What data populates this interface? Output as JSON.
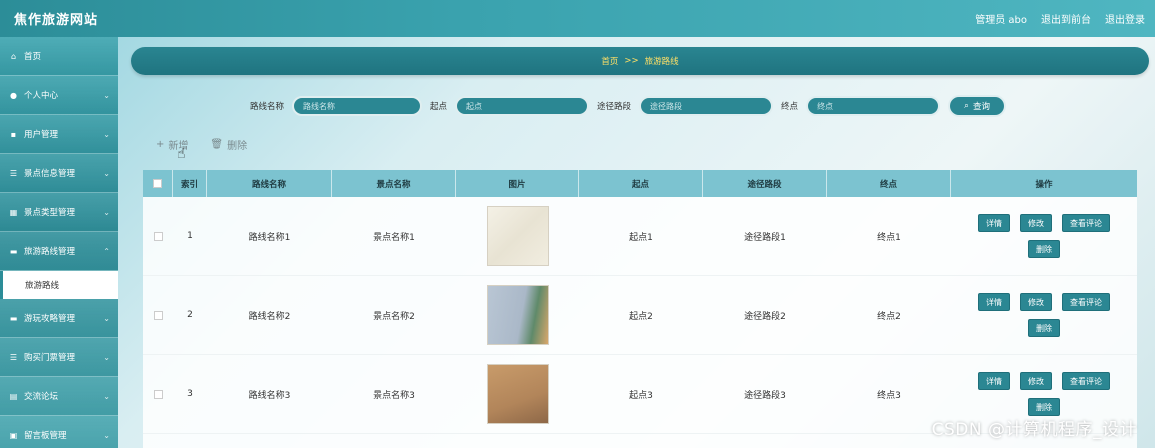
{
  "topbar": {
    "site_title": "焦作旅游网站",
    "admin_label": "管理员 abo",
    "to_front": "退出到前台",
    "logout": "退出登录"
  },
  "sidebar": {
    "items": [
      {
        "icon": "home-icon",
        "label": "首页"
      },
      {
        "icon": "user-icon",
        "label": "个人中心"
      },
      {
        "icon": "users-icon",
        "label": "用户管理"
      },
      {
        "icon": "list-icon",
        "label": "景点信息管理"
      },
      {
        "icon": "grid-icon",
        "label": "景点类型管理"
      },
      {
        "icon": "route-icon",
        "label": "旅游路线管理"
      }
    ],
    "active_sub": "旅游路线",
    "items_after": [
      {
        "icon": "guide-icon",
        "label": "游玩攻略管理"
      },
      {
        "icon": "ticket-icon",
        "label": "购买门票管理"
      },
      {
        "icon": "forum-icon",
        "label": "交流论坛"
      },
      {
        "icon": "message-icon",
        "label": "留言板管理"
      }
    ]
  },
  "breadcrumb": {
    "home": "首页",
    "sep": ">>",
    "current": "旅游路线"
  },
  "search": {
    "route_label": "路线名称",
    "route_placeholder": "路线名称",
    "start_label": "起点",
    "start_placeholder": "起点",
    "via_label": "途径路段",
    "via_placeholder": "途径路段",
    "end_label": "终点",
    "end_placeholder": "终点",
    "button_label": "查询"
  },
  "actions": {
    "add_label": "新增",
    "delete_label": "删除"
  },
  "table": {
    "headers": {
      "index": "索引",
      "route": "路线名称",
      "spot": "景点名称",
      "image": "图片",
      "start": "起点",
      "via": "途径路段",
      "end": "终点",
      "ops": "操作"
    },
    "rows": [
      {
        "index": "1",
        "route": "路线名称1",
        "spot": "景点名称1",
        "start": "起点1",
        "via": "途径路段1",
        "end": "终点1"
      },
      {
        "index": "2",
        "route": "路线名称2",
        "spot": "景点名称2",
        "start": "起点2",
        "via": "途径路段2",
        "end": "终点2"
      },
      {
        "index": "3",
        "route": "路线名称3",
        "spot": "景点名称3",
        "start": "起点3",
        "via": "途径路段3",
        "end": "终点3"
      }
    ],
    "op_labels": {
      "detail": "详情",
      "edit": "修改",
      "comments": "查看评论",
      "delete": "删除"
    }
  },
  "watermark": "CSDN @计算机程序_设计"
}
